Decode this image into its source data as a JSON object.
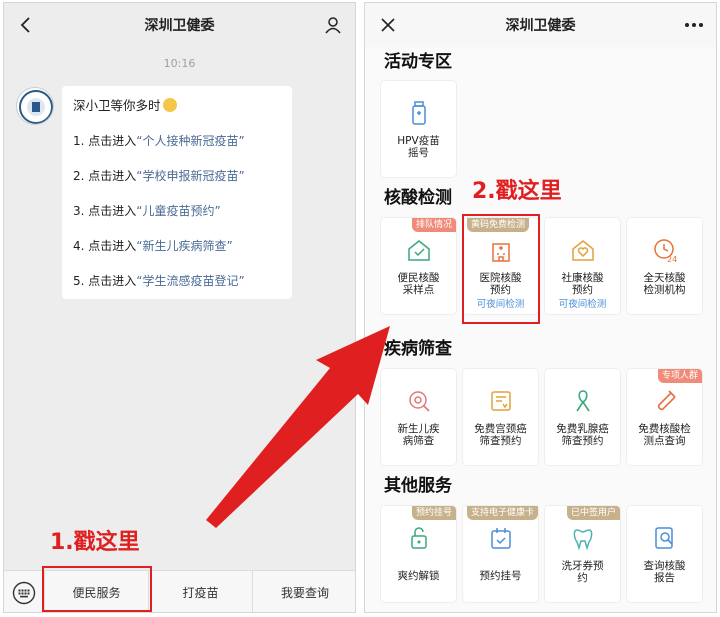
{
  "left": {
    "title": "深圳卫健委",
    "time": "10:16",
    "greeting": "深小卫等你多时",
    "items": [
      {
        "prefix": "1. 点击进入",
        "link": "“个人接种新冠疫苗”"
      },
      {
        "prefix": "2. 点击进入",
        "link": "“学校申报新冠疫苗”"
      },
      {
        "prefix": "3. 点击进入",
        "link": "“儿童疫苗预约”"
      },
      {
        "prefix": "4. 点击进入",
        "link": "“新生儿疾病筛查”"
      },
      {
        "prefix": "5. 点击进入",
        "link": "“学生流感疫苗登记”"
      }
    ],
    "menu": [
      "便民服务",
      "打疫苗",
      "我要查询"
    ],
    "step_label": "1.戳这里"
  },
  "right": {
    "title": "深圳卫健委",
    "sections": [
      "活动专区",
      "核酸检测",
      "疾病筛查",
      "其他服务"
    ],
    "activity": [
      {
        "l1": "HPV疫苗",
        "l2": "摇号",
        "icon": "vaccine-bottle-icon"
      }
    ],
    "nucleic": [
      {
        "badge": "排队情况",
        "l1": "便民核酸",
        "l2": "采样点",
        "sub": "",
        "icon": "house-check-icon"
      },
      {
        "badge": "黄码免费检测",
        "l1": "医院核酸",
        "l2": "预约",
        "sub": "可夜间检测",
        "icon": "hospital-icon"
      },
      {
        "badge": "",
        "l1": "社康核酸",
        "l2": "预约",
        "sub": "可夜间检测",
        "icon": "house-heart-icon"
      },
      {
        "badge": "",
        "l1": "全天核酸",
        "l2": "检测机构",
        "sub": "",
        "icon": "clock-24-icon"
      }
    ],
    "screening": [
      {
        "badge": "",
        "l1": "新生儿疾",
        "l2": "病筛查",
        "icon": "baby-search-icon"
      },
      {
        "badge": "",
        "l1": "免费宫颈癌",
        "l2": "筛查预约",
        "icon": "document-filter-icon"
      },
      {
        "badge": "",
        "l1": "免费乳腺癌",
        "l2": "筛查预约",
        "icon": "ribbon-icon"
      },
      {
        "badge": "专项人群",
        "l1": "免费核酸检",
        "l2": "测点查询",
        "icon": "test-tube-icon"
      }
    ],
    "other": [
      {
        "badge": "预约挂号",
        "l1": "爽约解锁",
        "l2": "",
        "icon": "unlock-icon"
      },
      {
        "badge": "支持电子健康卡",
        "l1": "预约挂号",
        "l2": "",
        "icon": "calendar-check-icon"
      },
      {
        "badge": "已中签用户",
        "l1": "洗牙券预",
        "l2": "约",
        "icon": "tooth-icon"
      },
      {
        "badge": "",
        "l1": "查询核酸",
        "l2": "报告",
        "icon": "report-search-icon"
      }
    ],
    "step_label": "2.戳这里"
  },
  "colors": {
    "accent": "#e02020",
    "link": "#4a6a95",
    "icon_orange": "#e8703a",
    "sub_blue": "#4a8fd6"
  }
}
